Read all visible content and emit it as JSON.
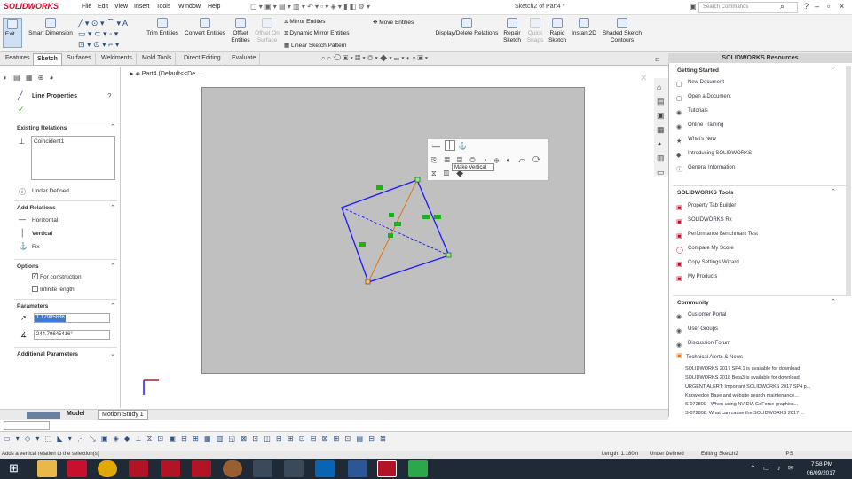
{
  "app": {
    "logo": "SOLIDWORKS",
    "menu": [
      "File",
      "Edit",
      "View",
      "Insert",
      "Tools",
      "Window",
      "Help"
    ],
    "doc_title": "Sketch2 of Part4 *",
    "search_placeholder": "Search Commands"
  },
  "commands": {
    "exit": "Exit...",
    "smart_dimension": "Smart Dimension",
    "trim": "Trim Entities",
    "convert": "Convert Entities",
    "offset": "Offset Entities",
    "offset_surface": "Offset On Surface",
    "mirror": "Mirror Entities",
    "dynamic_mirror": "Dynamic Mirror Entities",
    "linear_pattern": "Linear Sketch Pattern",
    "move": "Move Entities",
    "display_delete": "Display/Delete Relations",
    "repair": "Repair Sketch",
    "quick_snaps": "Quick Snaps",
    "rapid": "Rapid Sketch",
    "instant2d": "Instant2D",
    "shaded": "Shaded Sketch Contours"
  },
  "tabs": [
    "Features",
    "Sketch",
    "Surfaces",
    "Weldments",
    "Mold Tools",
    "Direct Editing",
    "Evaluate"
  ],
  "active_tab": "Sketch",
  "pm": {
    "title": "Line Properties",
    "existing_relations": "Existing Relations",
    "relation_item": "Coincident1",
    "status": "Under Defined",
    "add_relations": "Add Relations",
    "horizontal": "Horizontal",
    "vertical": "Vertical",
    "fix": "Fix",
    "options": "Options",
    "for_construction": "For construction",
    "infinite_length": "Infinite length",
    "parameters": "Parameters",
    "param1": "1.17985836",
    "param2": "244.79645416°",
    "additional": "Additional Parameters"
  },
  "tree": {
    "part": "Part4",
    "config": "(Default<<De..."
  },
  "popup": {
    "tooltip": "Make Vertical"
  },
  "taskpane": {
    "title": "SOLIDWORKS Resources",
    "getting_started": "Getting Started",
    "gs_items": [
      "New Document",
      "Open a Document",
      "Tutorials",
      "Online Training",
      "What's New",
      "Introducing SOLIDWORKS",
      "General Information"
    ],
    "tools": "SOLIDWORKS Tools",
    "tool_items": [
      "Property Tab Builder",
      "SOLIDWORKS Rx",
      "Performance Benchmark Test",
      "Compare My Score",
      "Copy Settings Wizard",
      "My Products"
    ],
    "community": "Community",
    "community_items": [
      "Customer Portal",
      "User Groups",
      "Discussion Forum"
    ],
    "alerts": "Technical Alerts & News",
    "news": [
      "SOLIDWORKS 2017 SP4.1 is available for download",
      "SOLIDWORKS 2018 Beta3 is available for download",
      "URGENT ALERT: Important SOLIDWORKS 2017 SP4 p...",
      "Knowledge Base and website search maintenance...",
      "S-072800 - When using NVIDIA GeForce graphics...",
      "S-072808: What can cause the SOLIDWORKS 2017 ..."
    ]
  },
  "bottom_tabs": [
    "Model",
    "Motion Study 1"
  ],
  "status": {
    "hint": "Adds a vertical relation to the selection(s)",
    "length": "Length: 1.180in",
    "defined": "Under Defined",
    "editing": "Editing Sketch2",
    "units": "IPS"
  },
  "clock": {
    "time": "7:58 PM",
    "date": "06/09/2017"
  },
  "colors": {
    "sketch_blue": "#1a1aff",
    "construction_orange": "#e07a1f",
    "relation_green": "#19b319",
    "accent_red": "#c8102e"
  }
}
